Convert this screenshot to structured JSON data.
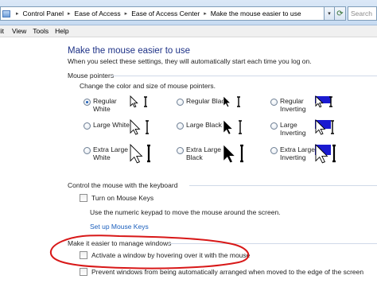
{
  "address": {
    "crumbs": [
      "Control Panel",
      "Ease of Access",
      "Ease of Access Center",
      "Make the mouse easier to use"
    ],
    "search_placeholder": "Search"
  },
  "menu": [
    "dit",
    "View",
    "Tools",
    "Help"
  ],
  "page": {
    "title": "Make the mouse easier to use",
    "subtitle": "When you select these settings, they will automatically start each time you log on."
  },
  "pointers": {
    "title": "Mouse pointers",
    "desc": "Change the color and size of mouse pointers.",
    "options": [
      {
        "label": "Regular\nWhite",
        "selected": true,
        "scheme": "white",
        "size": "regular"
      },
      {
        "label": "Regular Black",
        "selected": false,
        "scheme": "black",
        "size": "regular"
      },
      {
        "label": "Regular\nInverting",
        "selected": false,
        "scheme": "invert",
        "size": "regular"
      },
      {
        "label": "Large White",
        "selected": false,
        "scheme": "white",
        "size": "large"
      },
      {
        "label": "Large Black",
        "selected": false,
        "scheme": "black",
        "size": "large"
      },
      {
        "label": "Large\nInverting",
        "selected": false,
        "scheme": "invert",
        "size": "large"
      },
      {
        "label": "Extra Large\nWhite",
        "selected": false,
        "scheme": "white",
        "size": "xlarge"
      },
      {
        "label": "Extra Large\nBlack",
        "selected": false,
        "scheme": "black",
        "size": "xlarge"
      },
      {
        "label": "Extra Large\nInverting",
        "selected": false,
        "scheme": "invert",
        "size": "xlarge"
      }
    ]
  },
  "keyboard": {
    "title": "Control the mouse with the keyboard",
    "mousekeys_label": "Turn on Mouse Keys",
    "mousekeys_checked": false,
    "mousekeys_desc": "Use the numeric keypad to move the mouse around the screen.",
    "setup_link": "Set up Mouse Keys"
  },
  "windows": {
    "title": "Make it easier to manage windows",
    "hover_label": "Activate a window by hovering over it with the mouse",
    "hover_checked": false,
    "prevent_label": "Prevent windows from being automatically arranged when moved to the edge of the screen",
    "prevent_checked": false
  },
  "colors": {
    "title": "#1e3287",
    "link": "#1b5fbd",
    "annotation": "#d81818",
    "invert_bg": "#1a1ad0"
  }
}
